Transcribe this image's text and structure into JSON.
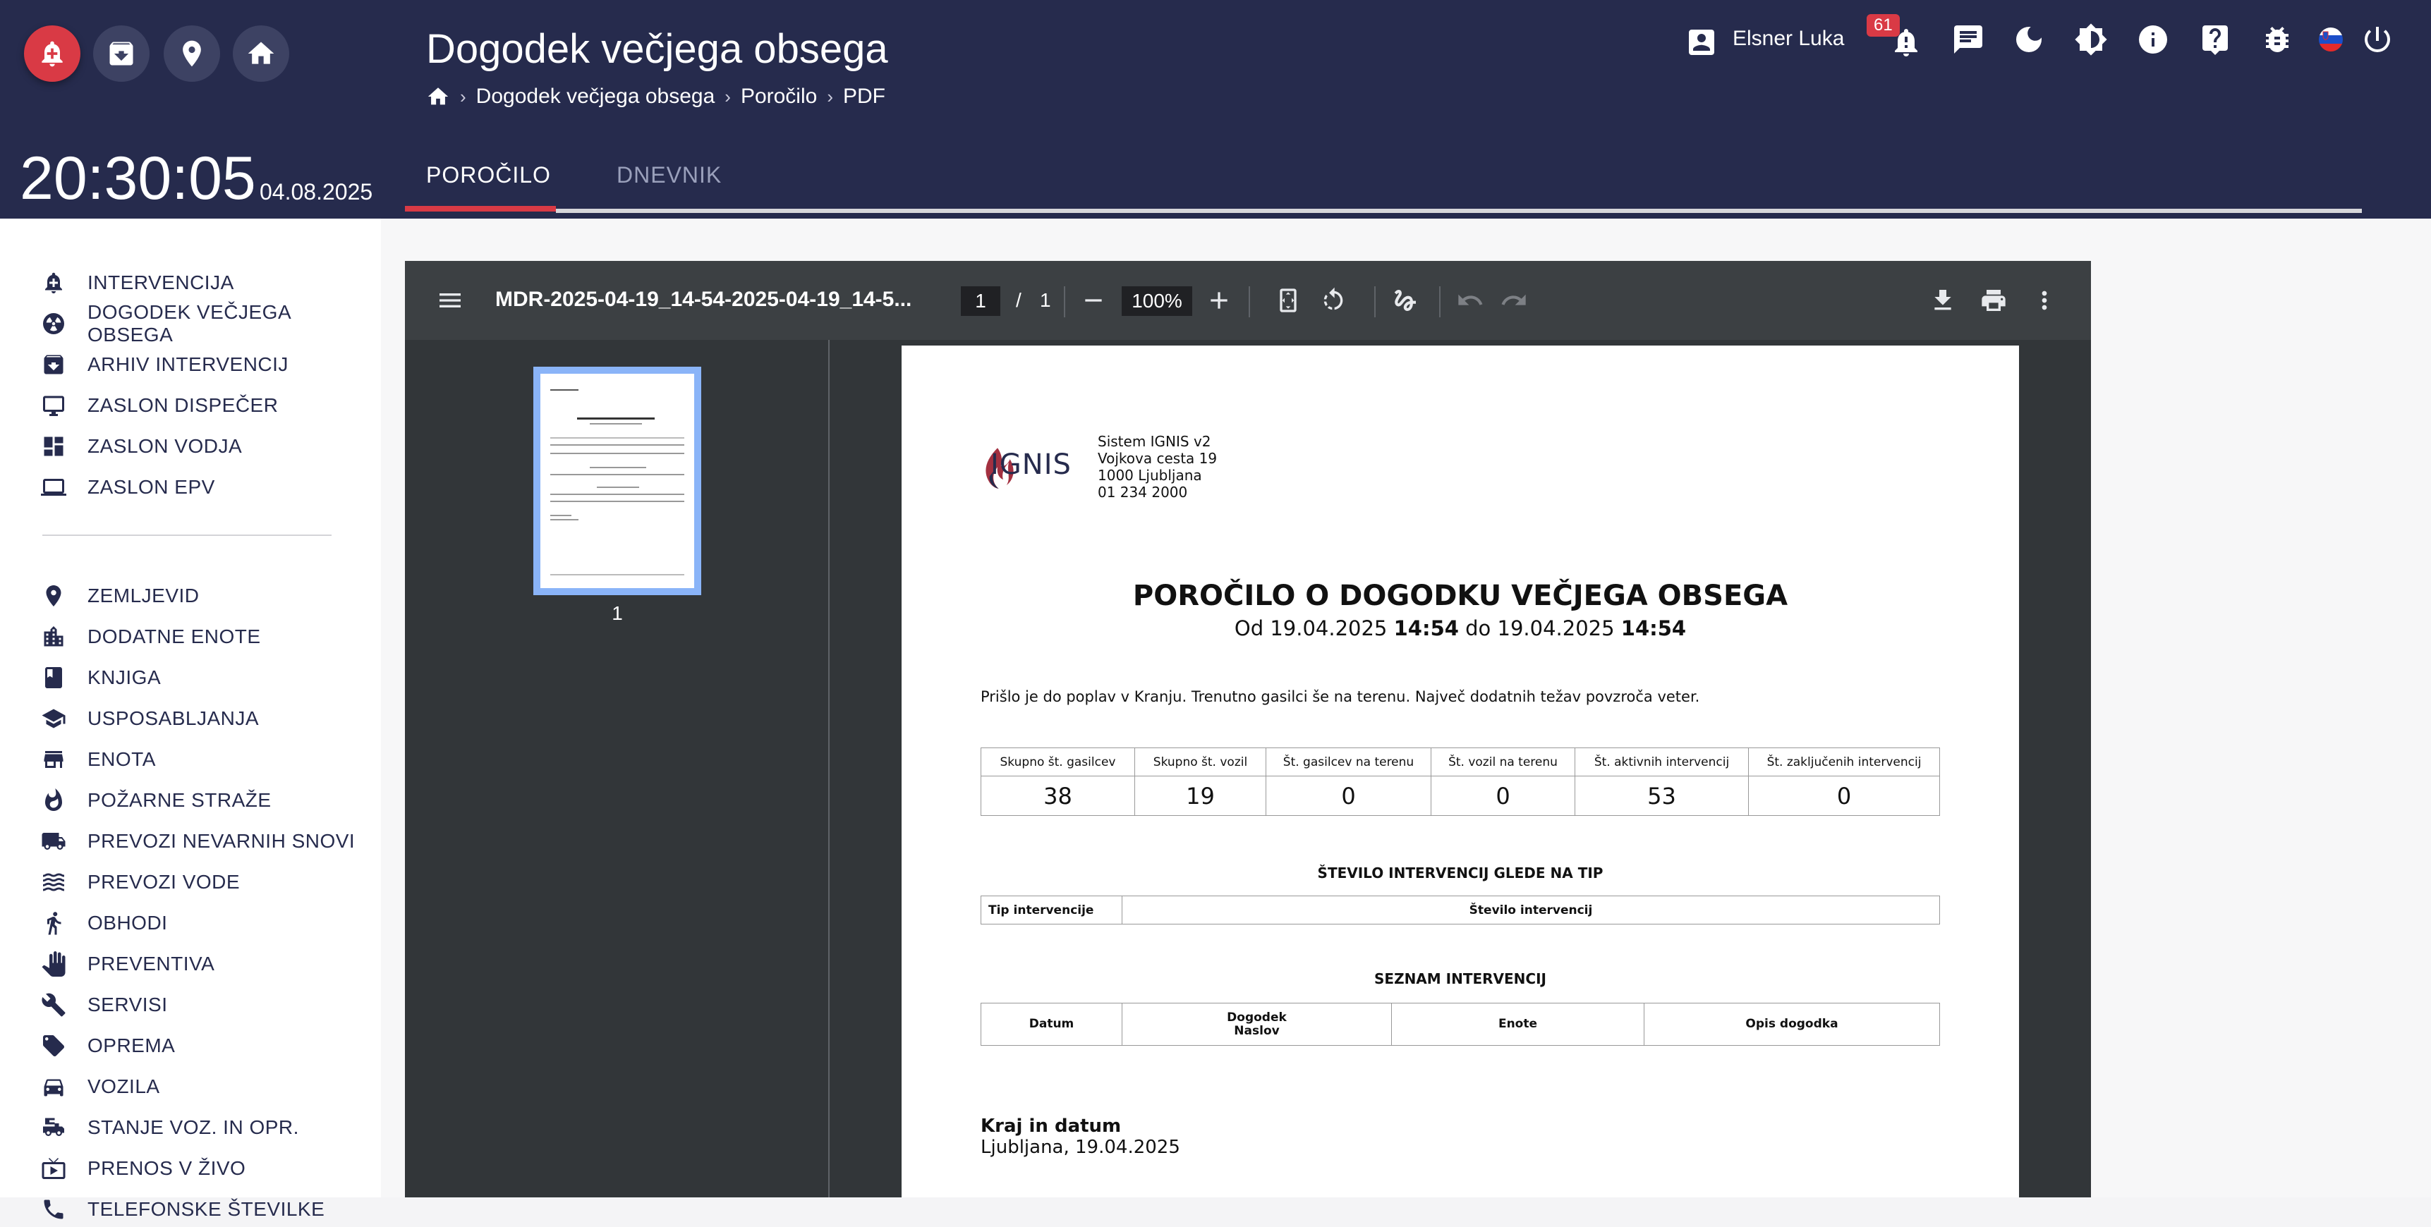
{
  "header": {
    "title": "Dogodek večjega obsega",
    "breadcrumb": [
      "Dogodek večjega obsega",
      "Poročilo",
      "PDF"
    ],
    "clock": "20:30:05",
    "date": "04.08.2025",
    "tabs": [
      "POROČILO",
      "DNEVNIK"
    ],
    "user_name": "Elsner Luka",
    "notification_count": "61"
  },
  "sidebar": {
    "group1": [
      "INTERVENCIJA",
      "DOGODEK VEČJEGA OBSEGA",
      "ARHIV INTERVENCIJ",
      "ZASLON DISPEČER",
      "ZASLON VODJA",
      "ZASLON EPV"
    ],
    "group2": [
      "ZEMLJEVID",
      "DODATNE ENOTE",
      "KNJIGA",
      "USPOSABLJANJA",
      "ENOTA",
      "POŽARNE STRAŽE",
      "PREVOZI NEVARNIH SNOVI",
      "PREVOZI VODE",
      "OBHODI",
      "PREVENTIVA",
      "SERVISI",
      "OPREMA",
      "VOZILA",
      "STANJE VOZ. IN OPR.",
      "PRENOS V ŽIVO",
      "TELEFONSKE ŠTEVILKE"
    ]
  },
  "viewer": {
    "filename": "MDR-2025-04-19_14-54-2025-04-19_14-5...",
    "page_current": "1",
    "page_sep": "/",
    "page_total": "1",
    "zoom": "100%",
    "thumb_label": "1"
  },
  "pdf": {
    "logo_text": "IGNIS",
    "address": [
      "Sistem IGNIS v2",
      "Vojkova cesta 19",
      "1000 Ljubljana",
      "01 234 2000"
    ],
    "title": "POROČILO O DOGODKU VEČJEGA OBSEGA",
    "period": {
      "from_label": "Od",
      "from_date": "19.04.2025",
      "from_time": "14:54",
      "to_label": "do",
      "to_date": "19.04.2025",
      "to_time": "14:54"
    },
    "description": "Prišlo je do poplav v Kranju. Trenutno gasilci še na terenu. Največ dodatnih težav povzroča veter.",
    "stats_headers": [
      "Skupno št. gasilcev",
      "Skupno št. vozil",
      "Št. gasilcev na terenu",
      "Št. vozil na terenu",
      "Št. aktivnih intervencij",
      "Št. zaključenih intervencij"
    ],
    "stats_values": [
      "38",
      "19",
      "0",
      "0",
      "53",
      "0"
    ],
    "section_type": "ŠTEVILO INTERVENCIJ GLEDE NA TIP",
    "type_headers": [
      "Tip intervencije",
      "Število intervencij"
    ],
    "section_list": "SEZNAM INTERVENCIJ",
    "list_headers": [
      "Datum",
      "Dogodek",
      "Naslov",
      "Enote",
      "Opis dogodka"
    ],
    "place_label": "Kraj in datum",
    "place_value": "Ljubljana, 19.04.2025"
  }
}
